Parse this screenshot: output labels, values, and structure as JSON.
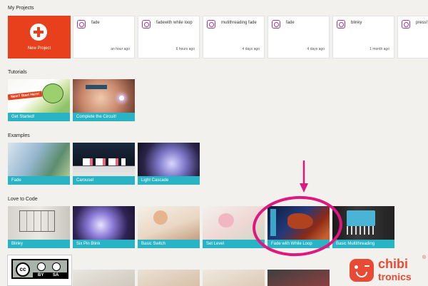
{
  "sections": {
    "my_projects": "My Projects",
    "tutorials": "Tutorials",
    "examples": "Examples",
    "love_to_code": "Love to Code"
  },
  "new_project": {
    "label": "New Project"
  },
  "projects": [
    {
      "name": "fade",
      "time": "an hour ago"
    },
    {
      "name": "fadewith while loop",
      "time": "6 hours ago"
    },
    {
      "name": "mutithreading fade",
      "time": "4 days ago"
    },
    {
      "name": "fade",
      "time": "4 days ago"
    },
    {
      "name": "blinky",
      "time": "1 month ago"
    },
    {
      "name": "press!",
      "time": ""
    }
  ],
  "tutorials": [
    {
      "label": "Get Started!",
      "badge": "New? Start Here!"
    },
    {
      "label": "Complete the Circuit!"
    }
  ],
  "examples": [
    {
      "label": "Fade"
    },
    {
      "label": "Carousel"
    },
    {
      "label": "Light Cascade"
    }
  ],
  "love_to_code": [
    {
      "label": "Blinky"
    },
    {
      "label": "Six Pin Blink"
    },
    {
      "label": "Basic Switch"
    },
    {
      "label": "Set Level"
    },
    {
      "label": "Fade with While Loop"
    },
    {
      "label": "Basic Multithreading"
    }
  ],
  "license": {
    "symbol": "cc",
    "by": "BY",
    "sa": "SA"
  },
  "brand": {
    "word1": "chibi",
    "word2": "tronics",
    "reg": "®"
  },
  "colors": {
    "accent_red": "#e8401c",
    "caption_teal": "#29b4c6",
    "annotation_magenta": "#e0177f",
    "project_icon": "#9c3a93"
  }
}
